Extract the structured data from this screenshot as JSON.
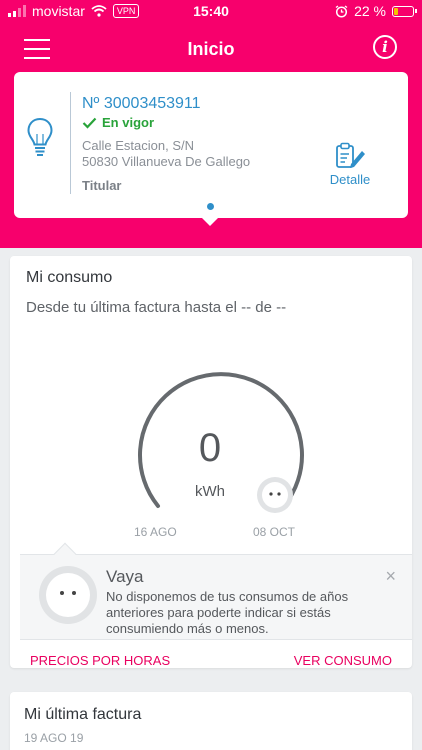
{
  "statusbar": {
    "carrier": "movistar",
    "vpn": "VPN",
    "time": "15:40",
    "battery_percent": "22 %",
    "battery_level": 0.22,
    "icons": [
      "signal-icon",
      "wifi-icon",
      "alarm-icon",
      "battery-icon"
    ]
  },
  "header": {
    "title": "Inicio",
    "menu_icon": "hamburger-menu-icon",
    "info_icon": "info-icon",
    "background_color": "#f7006c"
  },
  "supply_card": {
    "contract_number": "Nº 30003453911",
    "status": "En vigor",
    "address_line1": "Calle Estacion, S/N",
    "address_line2": "50830 Villanueva De Gallego",
    "role": "Titular",
    "detail_label": "Detalle",
    "icons": [
      "lightbulb-icon",
      "check-icon",
      "clipboard-edit-icon"
    ]
  },
  "consumo": {
    "title": "Mi consumo",
    "subtitle": "Desde tu última factura hasta el -- de --",
    "value": "0",
    "unit": "kWh",
    "start_date": "16 AGO",
    "end_date": "08 OCT",
    "message": {
      "title": "Vaya",
      "body": "No disponemos de tus consumos de años anteriores para poderte indicar si estás consumiendo más o menos.",
      "close": "×"
    },
    "link_left": "PRECIOS POR HORAS",
    "link_right": "VER CONSUMO"
  },
  "factura": {
    "title": "Mi última factura",
    "date": "19 AGO 19"
  },
  "colors": {
    "accent": "#f7006c",
    "link": "#e9005f",
    "blue": "#2f8fc9",
    "green": "#29a33a"
  }
}
